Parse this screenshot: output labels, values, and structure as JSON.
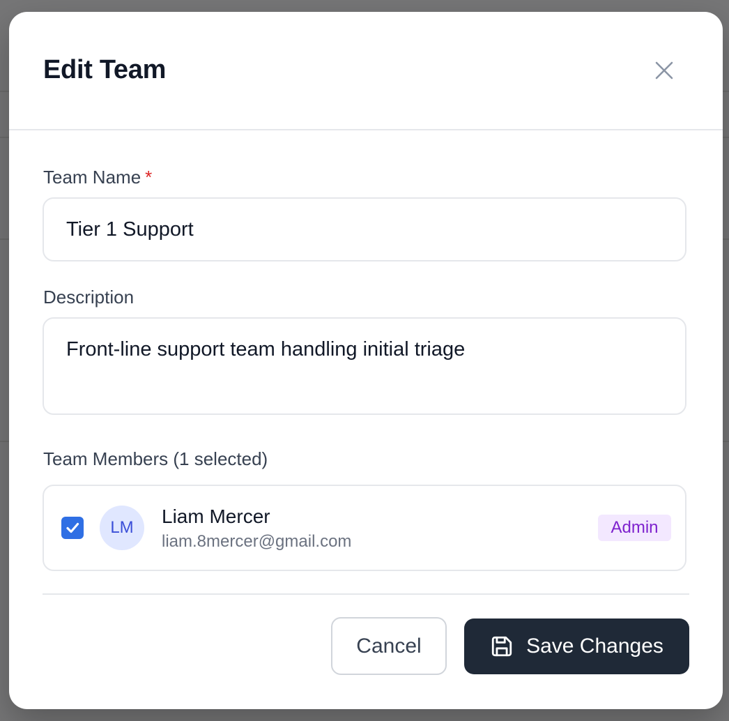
{
  "modal": {
    "title": "Edit Team",
    "close_icon": "close-icon"
  },
  "form": {
    "team_name": {
      "label": "Team Name",
      "required_marker": "*",
      "value": "Tier 1 Support"
    },
    "description": {
      "label": "Description",
      "value": "Front-line support team handling initial triage"
    },
    "members": {
      "label": "Team Members (1 selected)",
      "items": [
        {
          "checked": true,
          "initials": "LM",
          "name": "Liam Mercer",
          "email": "liam.8mercer@gmail.com",
          "role": "Admin"
        }
      ]
    }
  },
  "footer": {
    "cancel_label": "Cancel",
    "save_label": "Save Changes",
    "save_icon": "save-icon"
  },
  "colors": {
    "primary_dark": "#1f2937",
    "checkbox_blue": "#2f6fe4",
    "required_red": "#dc2626",
    "badge_bg": "#f3e8ff",
    "badge_text": "#7e22ce",
    "avatar_bg": "#e0e7ff"
  }
}
